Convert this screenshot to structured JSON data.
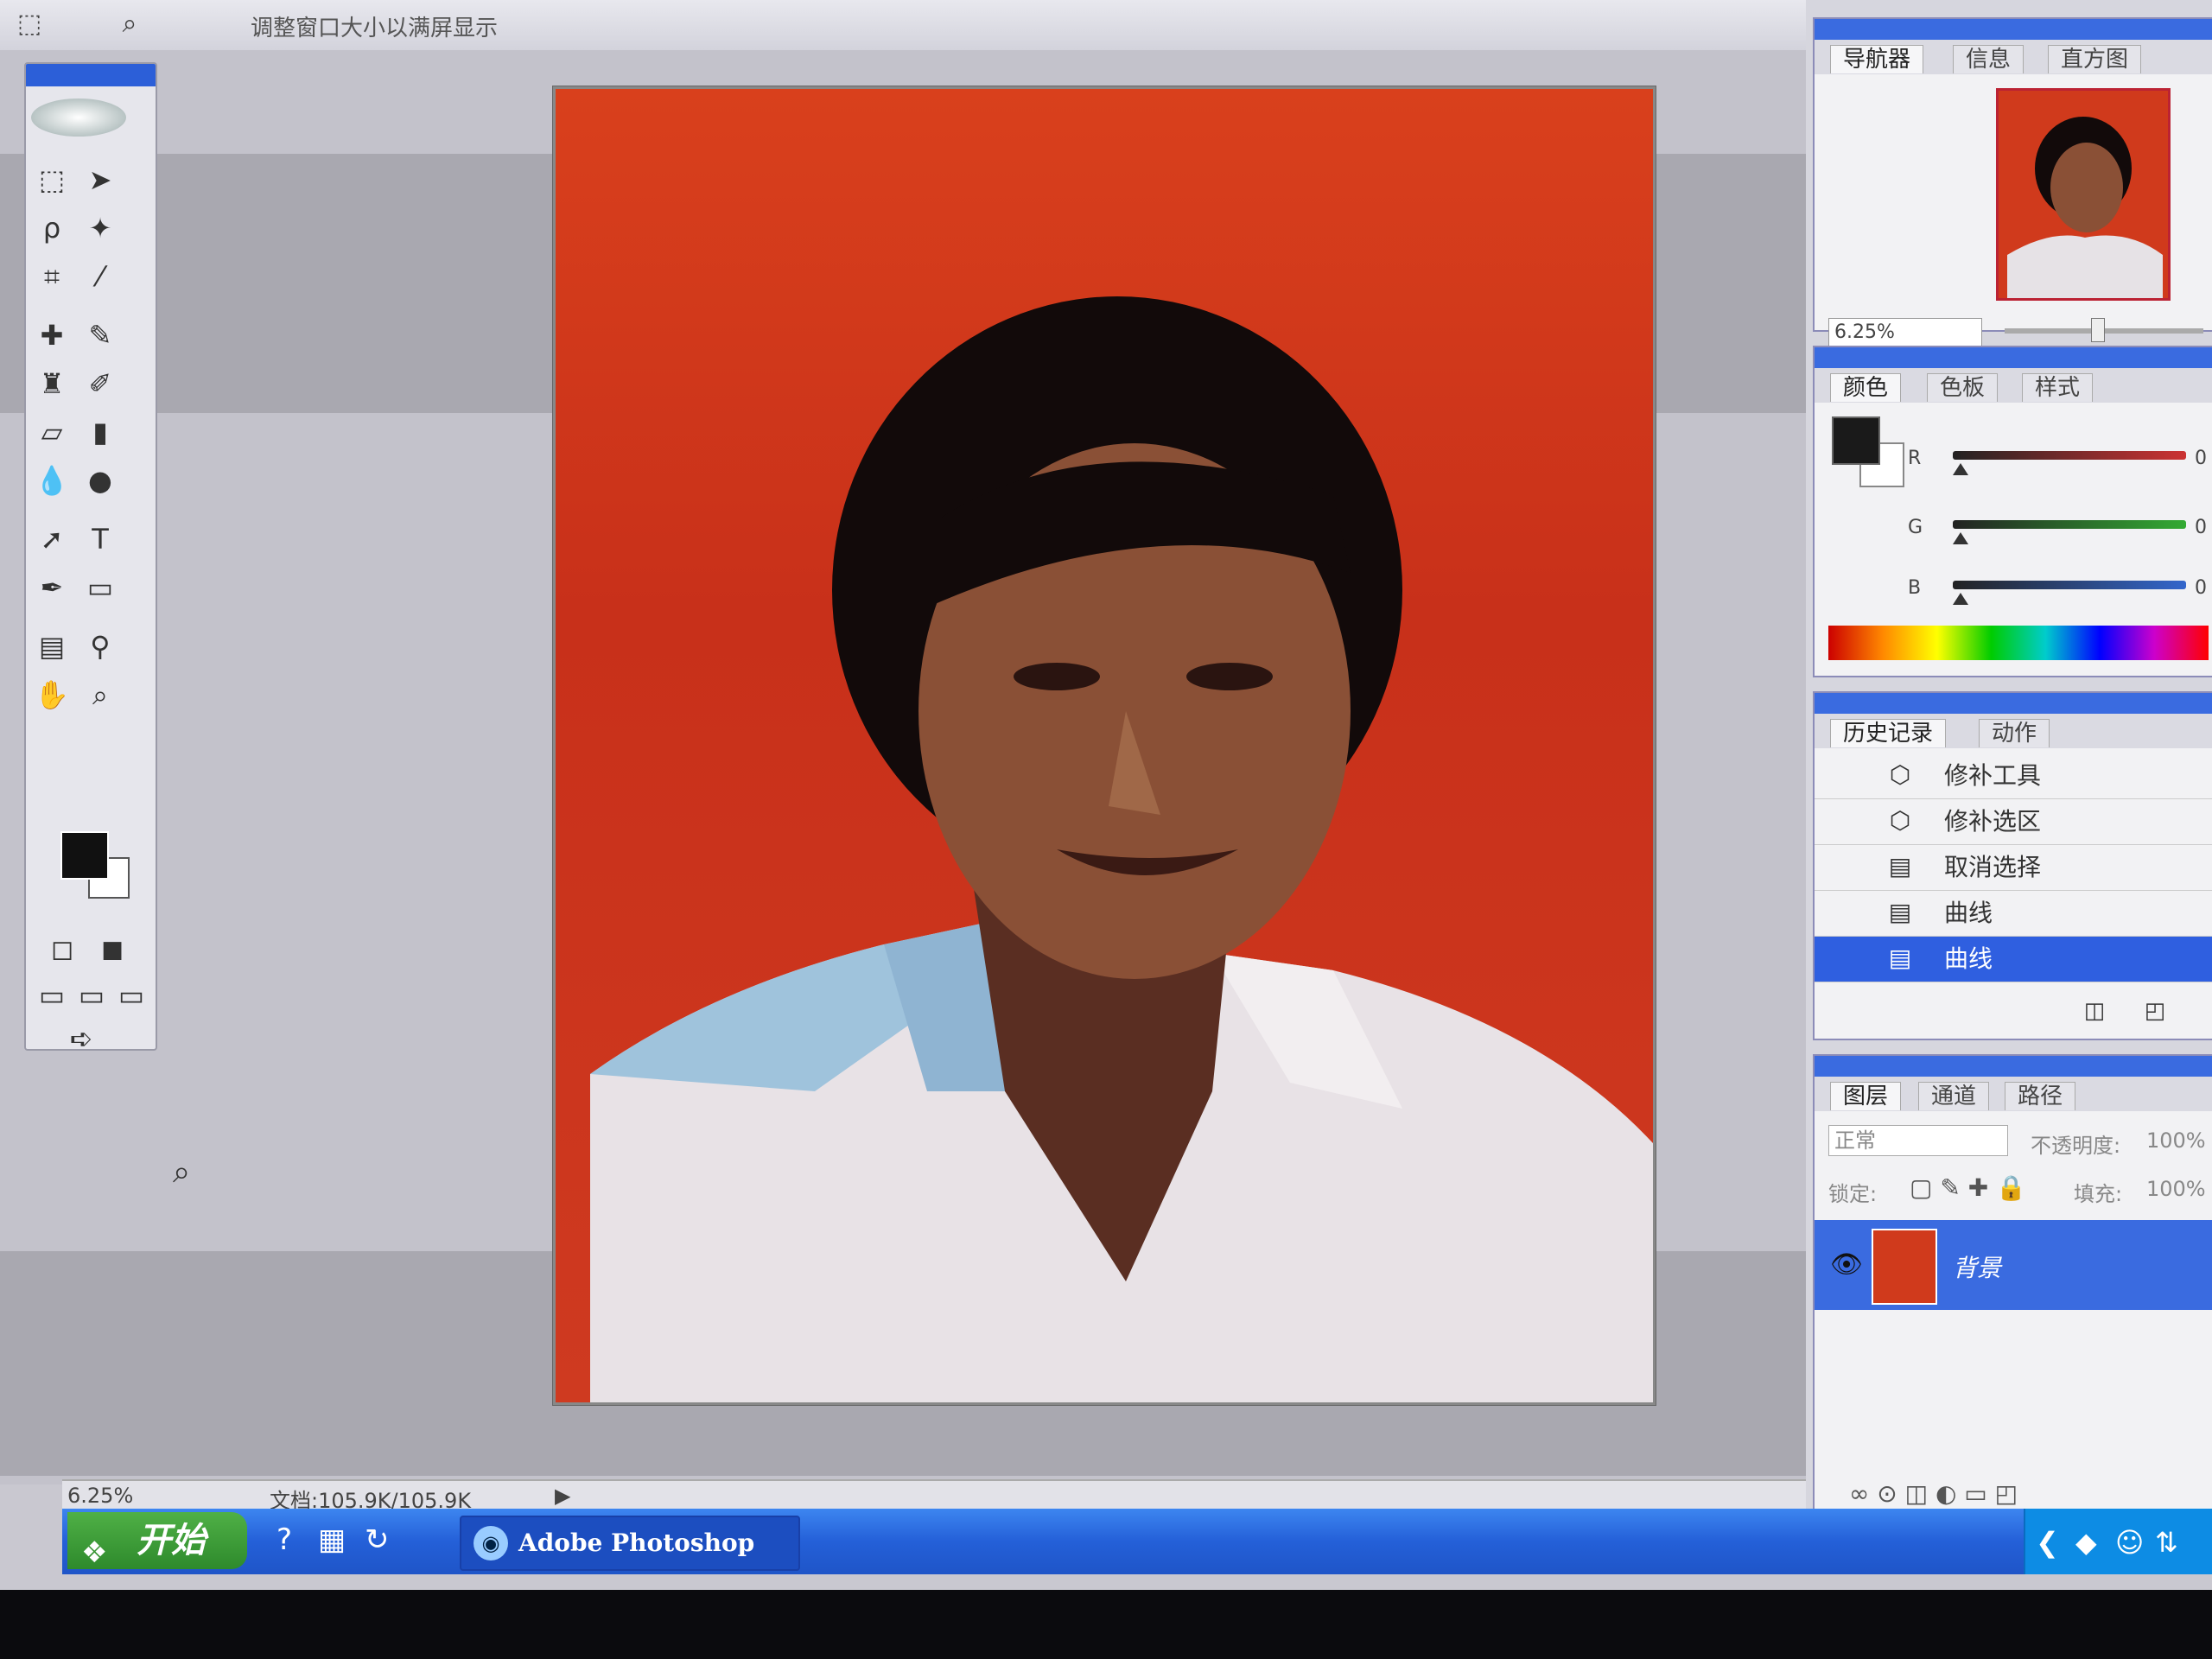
{
  "options_bar": {
    "tool_icon": "marquee-icon",
    "text": "调整窗口大小以满屏显示"
  },
  "toolbox": {
    "tools": [
      "rect-marquee-icon",
      "move-icon",
      "lasso-icon",
      "magic-wand-icon",
      "crop-icon",
      "slice-icon",
      "healing-brush-icon",
      "brush-icon",
      "clone-stamp-icon",
      "history-brush-icon",
      "eraser-icon",
      "gradient-icon",
      "blur-icon",
      "dodge-icon",
      "path-select-icon",
      "type-icon",
      "pen-icon",
      "shape-icon",
      "notes-icon",
      "eyedropper-icon",
      "hand-icon",
      "zoom-icon"
    ],
    "colors": {
      "foreground": "#111111",
      "background": "#ffffff"
    }
  },
  "status": {
    "zoom": "6.25%",
    "doc_size": "文档:105.9K/105.9K"
  },
  "navigator": {
    "tabs": [
      "导航器",
      "信息",
      "直方图"
    ],
    "zoom": "6.25%"
  },
  "color_panel": {
    "tabs": [
      "颜色",
      "色板",
      "样式"
    ],
    "channels": [
      {
        "name": "R",
        "value": "0",
        "color": "#cc3333"
      },
      {
        "name": "G",
        "value": "0",
        "color": "#33aa33"
      },
      {
        "name": "B",
        "value": "0",
        "color": "#3366cc"
      }
    ]
  },
  "history": {
    "tabs": [
      "历史记录",
      "动作"
    ],
    "items": [
      {
        "label": "修补工具"
      },
      {
        "label": "修补选区"
      },
      {
        "label": "取消选择"
      },
      {
        "label": "曲线"
      },
      {
        "label": "曲线"
      }
    ],
    "selected_index": 4
  },
  "layers": {
    "tabs": [
      "图层",
      "通道",
      "路径"
    ],
    "blend_mode": "正常",
    "opacity_label": "不透明度:",
    "opacity": "100%",
    "lock_label": "锁定:",
    "fill_label": "填充:",
    "fill": "100%",
    "layer_name": "背景"
  },
  "taskbar": {
    "start": "开始",
    "task": "Adobe Photoshop"
  },
  "accent": "#2f5fe0"
}
